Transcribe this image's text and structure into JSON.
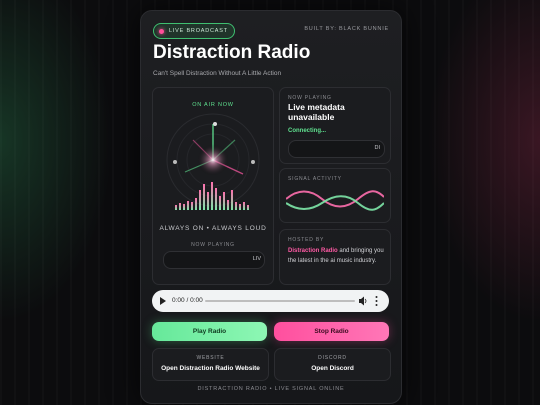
{
  "header": {
    "badge": "LIVE BROADCAST",
    "built_by": "BUILT BY: BLACK BUNNIE",
    "title": "Distraction Radio",
    "subtitle": "Can't Spell Distraction Without A Little Action"
  },
  "visualizer": {
    "on_air": "ON AIR NOW",
    "tagline": "ALWAYS ON • ALWAYS LOUD",
    "now_playing_label": "NOW PLAYING",
    "now_playing_value": "LIV"
  },
  "now_playing_card": {
    "label": "NOW PLAYING",
    "metadata": "Live metadata unavailable",
    "status": "Connecting...",
    "ticker": "DI"
  },
  "signal": {
    "label": "SIGNAL ACTIVITY"
  },
  "hosted": {
    "label": "HOSTED BY",
    "name": "Distraction Radio",
    "text": " and bringing you the latest in the ai music industry."
  },
  "player": {
    "time": "0:00 / 0:00",
    "progress": 0
  },
  "buttons": {
    "play": "Play Radio",
    "stop": "Stop Radio"
  },
  "links": {
    "website_label": "WEBSITE",
    "website_text": "Open Distraction Radio Website",
    "discord_label": "DISCORD",
    "discord_text": "Open Discord"
  },
  "footer": "DISTRACTION RADIO • LIVE SIGNAL ONLINE",
  "colors": {
    "accent_green": "#5fe08f",
    "accent_pink": "#ff5aa5",
    "card_bg": "#1b1c1f"
  }
}
